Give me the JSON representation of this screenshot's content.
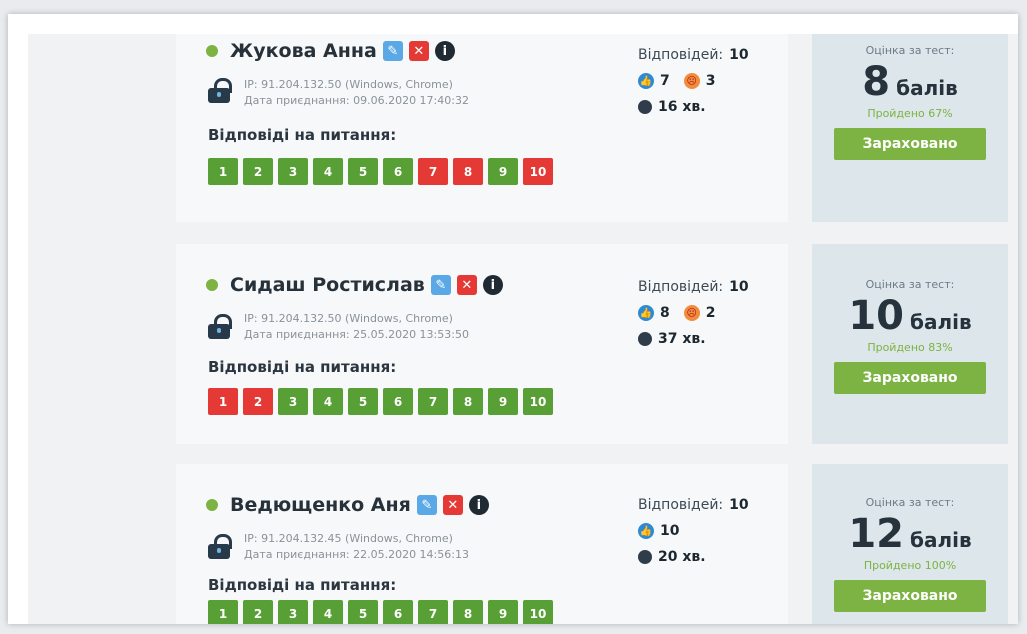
{
  "labels": {
    "ip_prefix": "IP:",
    "joined_prefix": "Дата приєднання:",
    "answers_on_questions": "Відповіді на питання:",
    "answers_prefix": "Відповідей:",
    "score_label": "Оцінка за тест:",
    "score_unit": "балів",
    "credit_button": "Зараховано",
    "minutes_unit": "хв."
  },
  "students": [
    {
      "name": "Жукова Анна",
      "ip_info": "IP: 91.204.132.50 (Windows, Chrome)",
      "joined": "Дата приєднання: 09.06.2020 17:40:32",
      "answers_total": "10",
      "likes": "7",
      "dislikes": "3",
      "time": "16 хв.",
      "score": "8",
      "passed": "Пройдено 67%",
      "questions": [
        {
          "n": "1",
          "status": "correct"
        },
        {
          "n": "2",
          "status": "correct"
        },
        {
          "n": "3",
          "status": "correct"
        },
        {
          "n": "4",
          "status": "correct"
        },
        {
          "n": "5",
          "status": "correct"
        },
        {
          "n": "6",
          "status": "correct"
        },
        {
          "n": "7",
          "status": "wrong"
        },
        {
          "n": "8",
          "status": "wrong"
        },
        {
          "n": "9",
          "status": "correct"
        },
        {
          "n": "10",
          "status": "wrong"
        }
      ]
    },
    {
      "name": "Сидаш Ростислав",
      "ip_info": "IP: 91.204.132.50 (Windows, Chrome)",
      "joined": "Дата приєднання: 25.05.2020 13:53:50",
      "answers_total": "10",
      "likes": "8",
      "dislikes": "2",
      "time": "37 хв.",
      "score": "10",
      "passed": "Пройдено 83%",
      "questions": [
        {
          "n": "1",
          "status": "wrong"
        },
        {
          "n": "2",
          "status": "wrong"
        },
        {
          "n": "3",
          "status": "correct"
        },
        {
          "n": "4",
          "status": "correct"
        },
        {
          "n": "5",
          "status": "correct"
        },
        {
          "n": "6",
          "status": "correct"
        },
        {
          "n": "7",
          "status": "correct"
        },
        {
          "n": "8",
          "status": "correct"
        },
        {
          "n": "9",
          "status": "correct"
        },
        {
          "n": "10",
          "status": "correct"
        }
      ]
    },
    {
      "name": "Ведющенко Аня",
      "ip_info": "IP: 91.204.132.45 (Windows, Chrome)",
      "joined": "Дата приєднання: 22.05.2020 14:56:13",
      "answers_total": "10",
      "likes": "10",
      "dislikes": "",
      "time": "20 хв.",
      "score": "12",
      "passed": "Пройдено 100%",
      "questions": [
        {
          "n": "1",
          "status": "correct"
        },
        {
          "n": "2",
          "status": "correct"
        },
        {
          "n": "3",
          "status": "correct"
        },
        {
          "n": "4",
          "status": "correct"
        },
        {
          "n": "5",
          "status": "correct"
        },
        {
          "n": "6",
          "status": "correct"
        },
        {
          "n": "7",
          "status": "correct"
        },
        {
          "n": "8",
          "status": "correct"
        },
        {
          "n": "9",
          "status": "correct"
        },
        {
          "n": "10",
          "status": "correct"
        }
      ]
    }
  ],
  "colors": {
    "correct": "#58a036",
    "wrong": "#e53935",
    "accent_green": "#7cb342",
    "info_blue": "#2f8ad6"
  }
}
